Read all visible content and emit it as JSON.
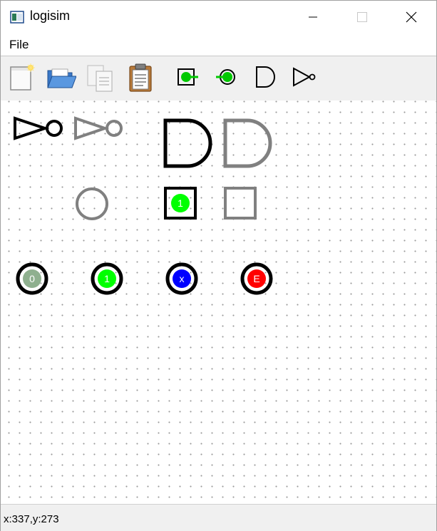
{
  "window": {
    "title": "logisim",
    "controls": [
      "minimize",
      "maximize",
      "close"
    ]
  },
  "menu": {
    "items": [
      "File"
    ]
  },
  "toolbar": {
    "tools": [
      "new-file-icon",
      "open-folder-icon",
      "copy-icon",
      "paste-icon",
      "output-pin-icon",
      "input-pin-icon",
      "and-gate-icon",
      "not-gate-icon"
    ]
  },
  "canvas": {
    "components": [
      {
        "type": "not-gate",
        "state": "selected"
      },
      {
        "type": "not-gate",
        "state": "ghost"
      },
      {
        "type": "and-gate",
        "state": "selected"
      },
      {
        "type": "and-gate",
        "state": "ghost"
      },
      {
        "type": "input-pin",
        "state": "ghost"
      },
      {
        "type": "output-pin",
        "state": "selected",
        "value": "1"
      },
      {
        "type": "output-pin",
        "state": "ghost"
      },
      {
        "type": "pin",
        "value": "0",
        "color": "#8fb08f"
      },
      {
        "type": "pin",
        "value": "1",
        "color": "#00ff00"
      },
      {
        "type": "pin",
        "value": "x",
        "color": "#0000ff"
      },
      {
        "type": "pin",
        "value": "E",
        "color": "#ff0000"
      }
    ]
  },
  "status": {
    "coordinates": "x:337,y:273"
  }
}
